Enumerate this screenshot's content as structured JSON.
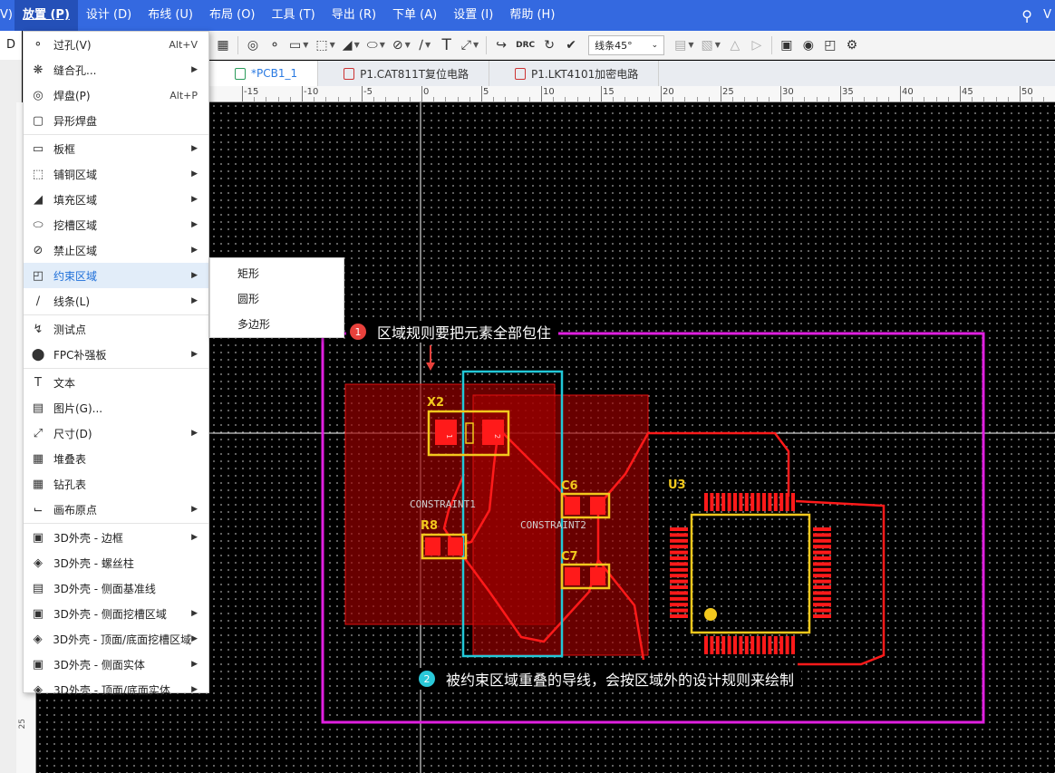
{
  "menubar": {
    "partial_left": "V)",
    "items": [
      "放置 (P)",
      "设计 (D)",
      "布线 (U)",
      "布局 (O)",
      "工具 (T)",
      "导出 (R)",
      "下单 (A)",
      "设置 (I)",
      "帮助 (H)"
    ],
    "partial_right": "V"
  },
  "toolbar": {
    "drc_label": "DRC",
    "line_mode": "线条45°"
  },
  "leftstrip": {
    "tab_label": "D"
  },
  "tabs": [
    {
      "label": "*PCB1_1",
      "active": true
    },
    {
      "label": "P1.CAT811T复位电路",
      "active": false
    },
    {
      "label": "P1.LKT4101加密电路",
      "active": false
    }
  ],
  "ruler": {
    "h_labels": [
      "-15",
      "-10",
      "-5",
      "0",
      "5",
      "10",
      "15",
      "20",
      "25",
      "30",
      "35",
      "40",
      "45",
      "50"
    ],
    "v_labels": [
      "25"
    ]
  },
  "place_menu": {
    "items": [
      {
        "label": "过孔(V)",
        "shortcut": "Alt+V",
        "icon": "via-icon",
        "submenu": false
      },
      {
        "label": "缝合孔...",
        "shortcut": "",
        "icon": "stitch-via-icon",
        "submenu": true
      },
      {
        "label": "焊盘(P)",
        "shortcut": "Alt+P",
        "icon": "pad-icon",
        "submenu": false
      },
      {
        "label": "异形焊盘",
        "shortcut": "",
        "icon": "custom-pad-icon",
        "submenu": false,
        "divider_after": true
      },
      {
        "label": "板框",
        "shortcut": "",
        "icon": "board-outline-icon",
        "submenu": true
      },
      {
        "label": "铺铜区域",
        "shortcut": "",
        "icon": "copper-area-icon",
        "submenu": true
      },
      {
        "label": "填充区域",
        "shortcut": "",
        "icon": "fill-area-icon",
        "submenu": true
      },
      {
        "label": "挖槽区域",
        "shortcut": "",
        "icon": "slot-area-icon",
        "submenu": true
      },
      {
        "label": "禁止区域",
        "shortcut": "",
        "icon": "forbidden-area-icon",
        "submenu": true
      },
      {
        "label": "约束区域",
        "shortcut": "",
        "icon": "constraint-area-icon",
        "submenu": true,
        "highlight": true
      },
      {
        "label": "线条(L)",
        "shortcut": "",
        "icon": "line-icon",
        "submenu": true,
        "divider_after": true
      },
      {
        "label": "测试点",
        "shortcut": "",
        "icon": "test-point-icon",
        "submenu": false
      },
      {
        "label": "FPC补强板",
        "shortcut": "",
        "icon": "fpc-stiffener-icon",
        "submenu": true,
        "divider_after": true
      },
      {
        "label": "文本",
        "shortcut": "",
        "icon": "text-icon",
        "submenu": false
      },
      {
        "label": "图片(G)...",
        "shortcut": "",
        "icon": "image-icon",
        "submenu": false
      },
      {
        "label": "尺寸(D)",
        "shortcut": "",
        "icon": "dimension-icon",
        "submenu": true
      },
      {
        "label": "堆叠表",
        "shortcut": "",
        "icon": "stackup-table-icon",
        "submenu": false
      },
      {
        "label": "钻孔表",
        "shortcut": "",
        "icon": "drill-table-icon",
        "submenu": false
      },
      {
        "label": "画布原点",
        "shortcut": "",
        "icon": "canvas-origin-icon",
        "submenu": true,
        "divider_after": true
      },
      {
        "label": "3D外壳 - 边框",
        "shortcut": "",
        "icon": "3d-shell-frame-icon",
        "submenu": true
      },
      {
        "label": "3D外壳 - 螺丝柱",
        "shortcut": "",
        "icon": "3d-screw-post-icon",
        "submenu": false
      },
      {
        "label": "3D外壳 - 侧面基准线",
        "shortcut": "",
        "icon": "3d-side-baseline-icon",
        "submenu": false
      },
      {
        "label": "3D外壳 - 侧面挖槽区域",
        "shortcut": "",
        "icon": "3d-side-slot-icon",
        "submenu": true
      },
      {
        "label": "3D外壳 - 顶面/底面挖槽区域",
        "shortcut": "",
        "icon": "3d-top-bottom-slot-icon",
        "submenu": true
      },
      {
        "label": "3D外壳 - 侧面实体",
        "shortcut": "",
        "icon": "3d-side-solid-icon",
        "submenu": true
      },
      {
        "label": "3D外壳 - 顶面/底面实体",
        "shortcut": "",
        "icon": "3d-top-bottom-solid-icon",
        "submenu": true
      }
    ]
  },
  "submenu": {
    "items": [
      "矩形",
      "圆形",
      "多边形"
    ]
  },
  "callouts": [
    {
      "number": "1",
      "text": "区域规则要把元素全部包住",
      "color": "#e8413c"
    },
    {
      "number": "2",
      "text": "被约束区域重叠的导线，会按区域外的设计规则来绘制",
      "color": "#2ac8d8"
    }
  ],
  "pcb": {
    "labels": {
      "constraint1": "CONSTRAINT1",
      "constraint2": "CONSTRAINT2",
      "x2": "X2",
      "r8": "R8",
      "c6": "C6",
      "c7": "C7",
      "u3": "U3",
      "pad1": "1",
      "pad2": "2"
    },
    "colors": {
      "board_outline": "#e020e0",
      "constraint_region": "#a00000",
      "highlight_box": "#22c8d8",
      "trace": "#e01010",
      "silkscreen": "#f2c81d",
      "pad": "#ff1a1a"
    }
  }
}
